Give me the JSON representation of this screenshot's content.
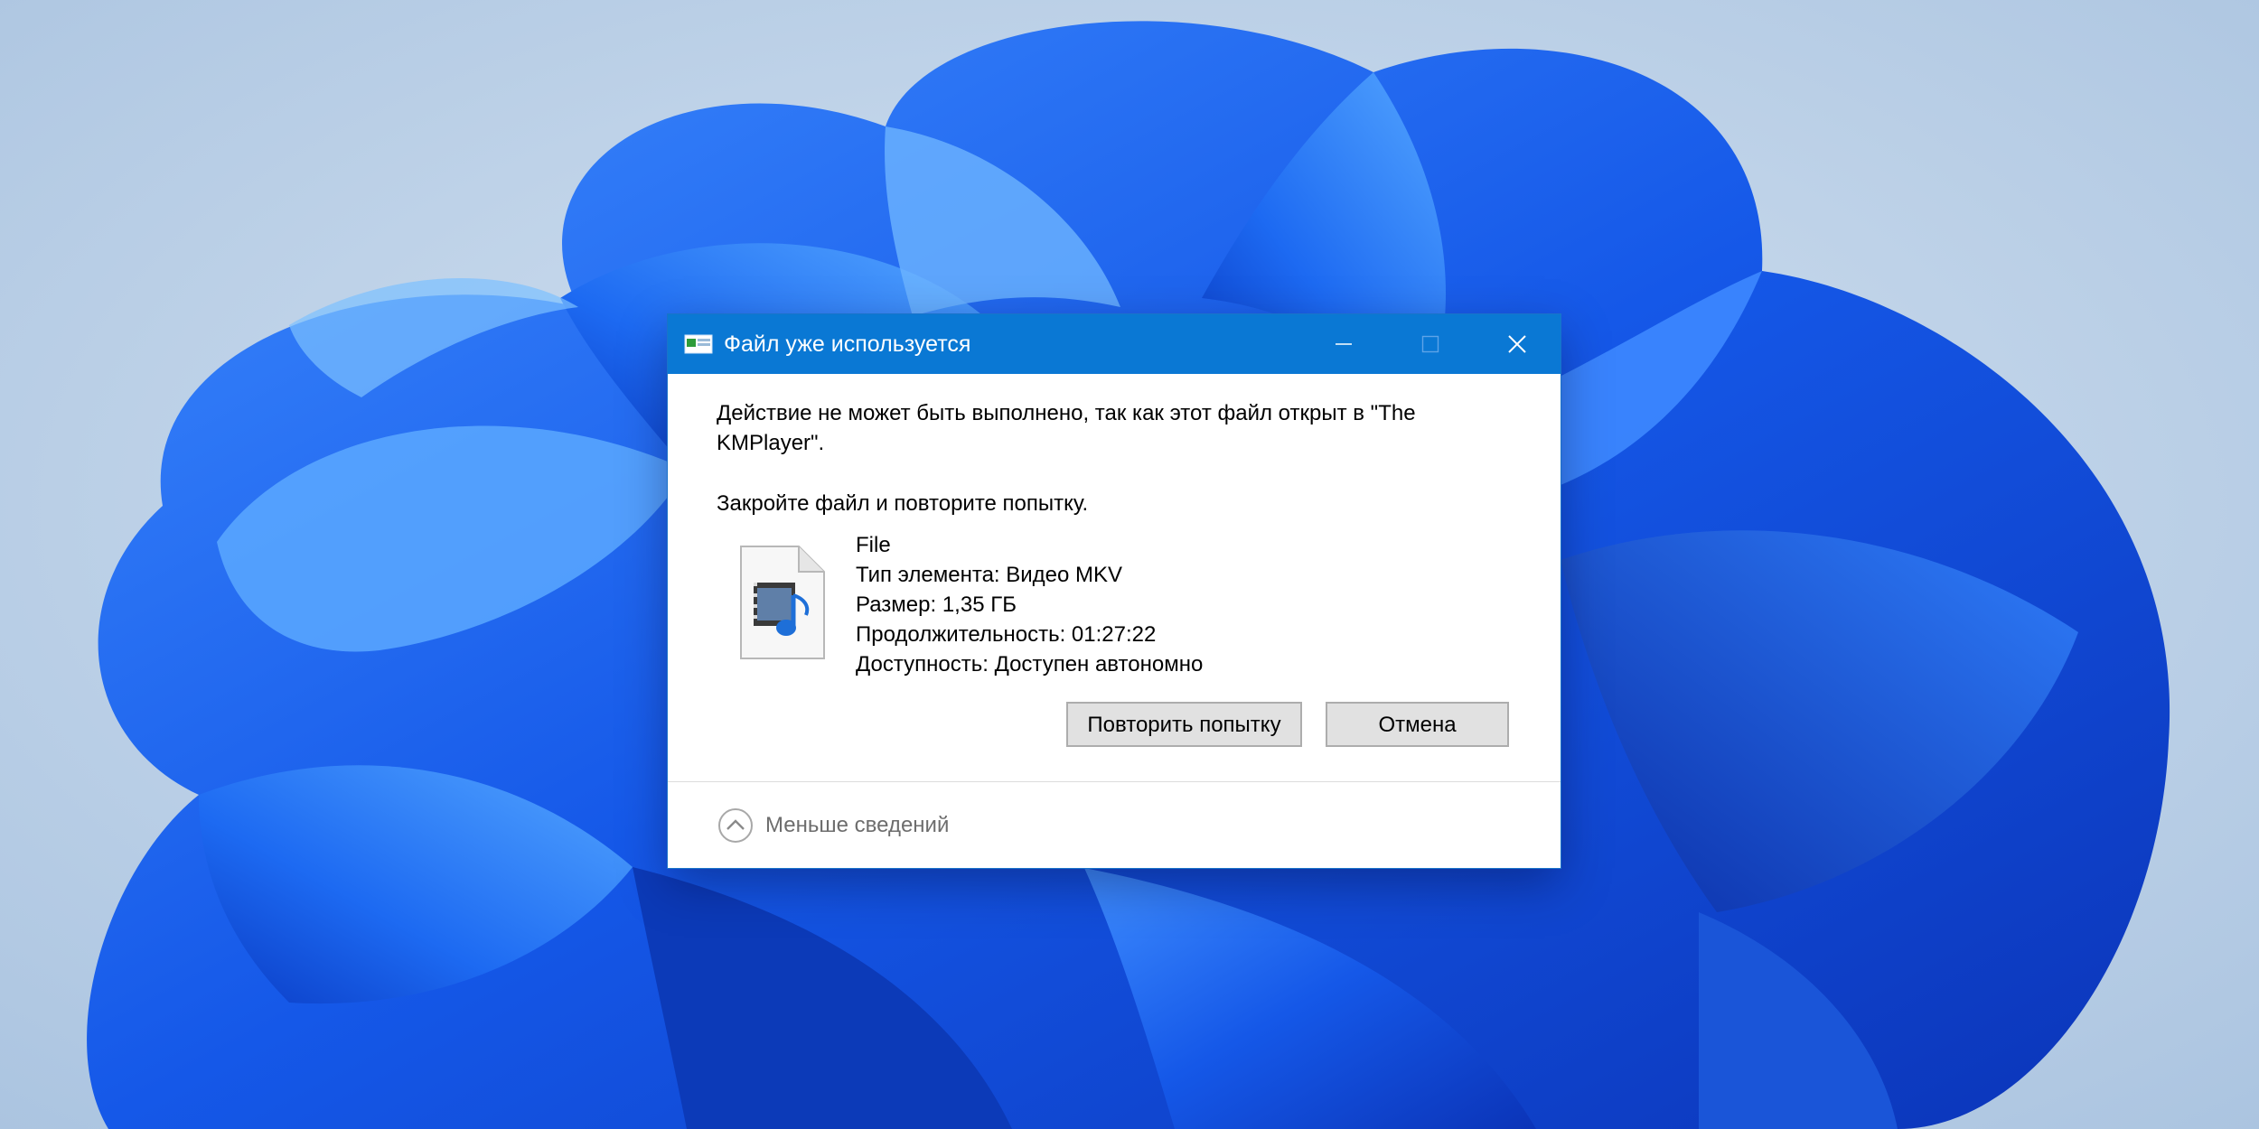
{
  "colors": {
    "titlebar": "#0a78d4",
    "wallpaper_bg": "#b9cee6",
    "wallpaper_bloom": "#1a63f0",
    "button_face": "#e1e1e1",
    "secondary_text": "#6d6d6d"
  },
  "dialog": {
    "title": "Файл уже используется",
    "icons": {
      "app": "file-in-use-icon",
      "minimize": "minimize-icon",
      "maximize": "maximize-icon",
      "close": "close-icon",
      "file": "video-file-icon",
      "collapse": "chevron-up-circle-icon"
    },
    "message_line1": "Действие не может быть выполнено, так как этот файл открыт в \"The",
    "message_line2": "KMPlayer\".",
    "instruction": "Закройте файл и повторите попытку.",
    "file": {
      "name": "File",
      "type": "Тип элемента: Видео MKV",
      "size": "Размер: 1,35 ГБ",
      "duration": "Продолжительность: 01:27:22",
      "availability": "Доступность: Доступен автономно"
    },
    "buttons": {
      "retry": "Повторить попытку",
      "cancel": "Отмена"
    },
    "less_details": "Меньше сведений"
  }
}
